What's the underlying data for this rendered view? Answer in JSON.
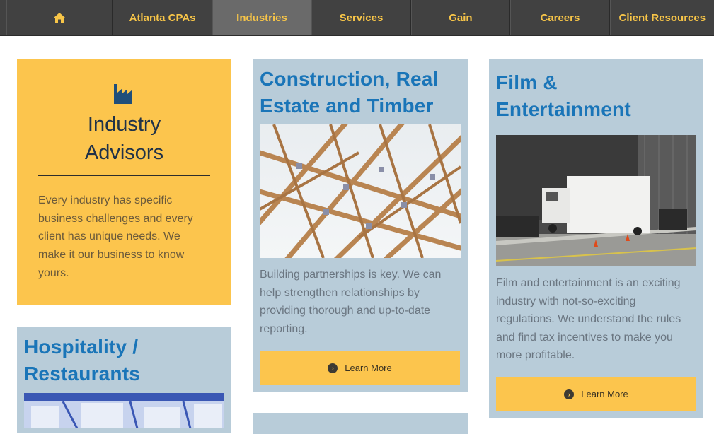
{
  "nav": {
    "items": [
      {
        "label": "",
        "icon": "home-icon"
      },
      {
        "label": "Atlanta CPAs"
      },
      {
        "label": "Industries",
        "active": true
      },
      {
        "label": "Services"
      },
      {
        "label": "Gain"
      },
      {
        "label": "Careers"
      },
      {
        "label": "Client Resources"
      }
    ]
  },
  "intro": {
    "icon": "factory-icon",
    "title_line1": "Industry",
    "title_line2": "Advisors",
    "text_lines": [
      "Every industry has specific",
      "business challenges and every",
      "client has unique needs. We",
      "make it our business to know",
      "yours."
    ]
  },
  "construction": {
    "title_line1": "Construction, Real",
    "title_line2": "Estate and Timber",
    "text_lines": [
      "Building partnerships is key. We can",
      "help strengthen relationships by",
      "providing thorough and up-to-date",
      "reporting."
    ],
    "button": "Learn More"
  },
  "film": {
    "title_line1": "Film &",
    "title_line2": "Entertainment",
    "text_lines": [
      "Film and entertainment is an exciting",
      "industry with not-so-exciting",
      "regulations. We understand the rules",
      "and find tax incentives to make you",
      "more profitable."
    ],
    "button": "Learn More"
  },
  "hospitality": {
    "title_line1": "Hospitality /",
    "title_line2": "Restaurants"
  },
  "colors": {
    "nav_bg": "#414141",
    "nav_text": "#f7c548",
    "accent_yellow": "#fcc54d",
    "card_blue": "#b8ccd9",
    "title_blue": "#1a75b8"
  }
}
